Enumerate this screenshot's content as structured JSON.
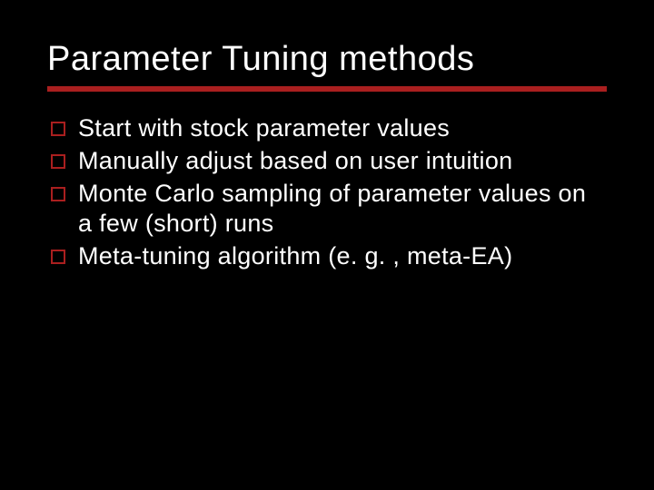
{
  "slide": {
    "title": "Parameter Tuning methods",
    "bullets": [
      "Start with stock parameter values",
      "Manually adjust based on user intuition",
      "Monte Carlo sampling of parameter values on a few (short) runs",
      "Meta-tuning algorithm (e. g. , meta-EA)"
    ]
  },
  "colors": {
    "background": "#000000",
    "text": "#ffffff",
    "accent": "#aa1f1f"
  }
}
